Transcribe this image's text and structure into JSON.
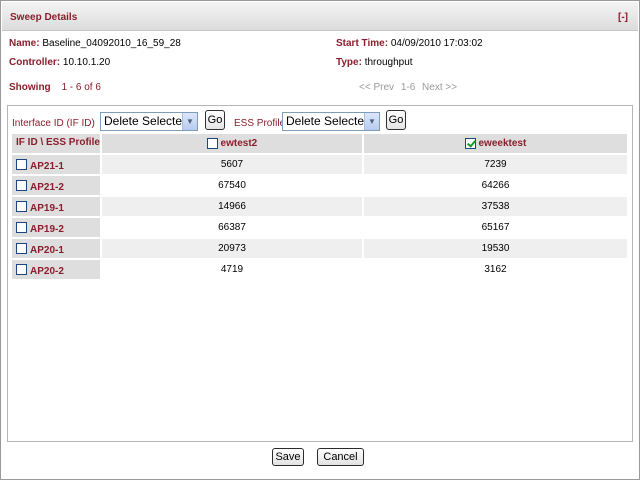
{
  "header": {
    "title": "Sweep Details",
    "collapse_label": "[-]"
  },
  "info": {
    "name_label": "Name:",
    "name_value": "Baseline_04092010_16_59_28",
    "start_label": "Start Time:",
    "start_value": "04/09/2010 17:03:02",
    "controller_label": "Controller:",
    "controller_value": "10.10.1.20",
    "type_label": "Type:",
    "type_value": "throughput"
  },
  "paging": {
    "showing_label": "Showing",
    "showing_value": "1 - 6 of 6",
    "prev": "<< Prev",
    "range": "1-6",
    "next": "Next >>"
  },
  "filters": {
    "interface_label": "Interface ID (IF ID)",
    "interface_select": "Delete Selected",
    "interface_go": "Go",
    "ess_label": "ESS Profile",
    "ess_select": "Delete Selected",
    "ess_go": "Go"
  },
  "table": {
    "corner_header": "IF ID \\ ESS Profile",
    "columns": [
      {
        "label": "ewtest2",
        "checked": false
      },
      {
        "label": "eweektest",
        "checked": true
      }
    ],
    "rows": [
      {
        "id": "AP21-1",
        "values": [
          "5607",
          "7239"
        ]
      },
      {
        "id": "AP21-2",
        "values": [
          "67540",
          "64266"
        ]
      },
      {
        "id": "AP19-1",
        "values": [
          "14966",
          "37538"
        ]
      },
      {
        "id": "AP19-2",
        "values": [
          "66387",
          "65167"
        ]
      },
      {
        "id": "AP20-1",
        "values": [
          "20973",
          "19530"
        ]
      },
      {
        "id": "AP20-2",
        "values": [
          "4719",
          "3162"
        ]
      }
    ]
  },
  "footer": {
    "save_label": "Save",
    "cancel_label": "Cancel"
  },
  "colors": {
    "accent": "#8b1e2c",
    "header_bg": "#dedede",
    "row_alt_bg": "#efefef"
  }
}
